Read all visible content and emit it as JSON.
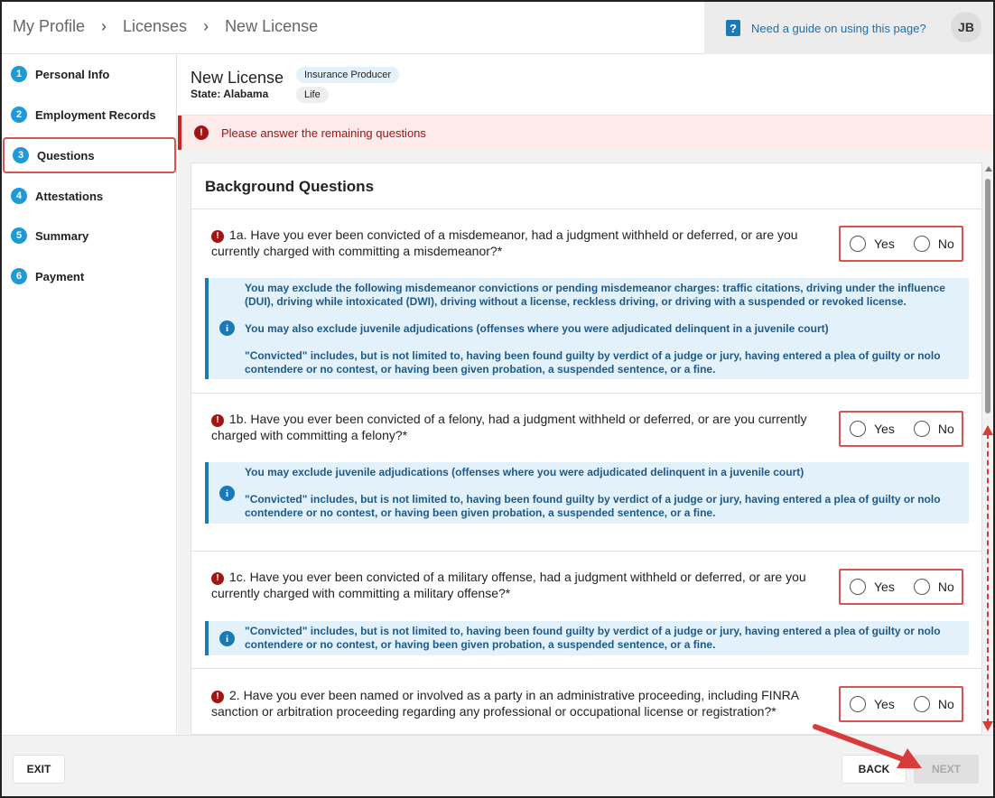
{
  "breadcrumb": [
    "My Profile",
    "Licenses",
    "New License"
  ],
  "guide": {
    "icon": "question-icon",
    "label": "Need a guide on using this page?"
  },
  "user": {
    "initials": "JB"
  },
  "steps": [
    {
      "num": "1",
      "label": "Personal Info"
    },
    {
      "num": "2",
      "label": "Employment Records"
    },
    {
      "num": "3",
      "label": "Questions",
      "active": true
    },
    {
      "num": "4",
      "label": "Attestations"
    },
    {
      "num": "5",
      "label": "Summary"
    },
    {
      "num": "6",
      "label": "Payment"
    }
  ],
  "license": {
    "title": "New License",
    "state": "State: Alabama",
    "chips": [
      "Insurance Producer",
      "Life"
    ]
  },
  "alert": {
    "icon": "error-icon",
    "text": "Please answer the remaining questions"
  },
  "section": {
    "title": "Background Questions"
  },
  "options": {
    "yes": "Yes",
    "no": "No"
  },
  "questions": [
    {
      "text": "1a. Have you ever been convicted of a misdemeanor, had a judgment withheld or deferred, or are you currently charged with committing a misdemeanor?*",
      "info": [
        "You may exclude the following misdemeanor convictions or pending misdemeanor charges: traffic citations, driving under the influence (DUI), driving while intoxicated (DWI), driving without a license, reckless driving, or driving with a suspended or revoked license.",
        "You may also exclude juvenile adjudications (offenses where you were adjudicated delinquent in a juvenile court)",
        "\"Convicted\" includes, but is not limited to, having been found guilty by verdict of a judge or jury, having entered a plea of guilty or nolo contendere or no contest, or having been given probation, a suspended sentence, or a fine."
      ]
    },
    {
      "text": "1b. Have you ever been convicted of a felony, had a judgment withheld or deferred, or are you currently charged with committing a felony?*",
      "info": [
        "You may exclude juvenile adjudications (offenses where you were adjudicated delinquent in a juvenile court)",
        "\"Convicted\" includes, but is not limited to, having been found guilty by verdict of a judge or jury, having entered a plea of guilty or nolo contendere or no contest, or having been given probation, a suspended sentence, or a fine."
      ]
    },
    {
      "text": "1c. Have you ever been convicted of a military offense, had a judgment withheld or deferred, or are you currently charged with committing a military offense?*",
      "info": [
        "\"Convicted\" includes, but is not limited to, having been found guilty by verdict of a judge or jury, having entered a plea of guilty or nolo contendere or no contest, or having been given probation, a suspended sentence, or a fine."
      ]
    },
    {
      "text": "2. Have you ever been named or involved as a party in an administrative proceeding, including FINRA sanction or arbitration proceeding regarding any professional or occupational license or registration?*"
    }
  ],
  "footer": {
    "exit": "EXIT",
    "back": "BACK",
    "next": "NEXT"
  },
  "colors": {
    "accent": "#1e9ad6",
    "error": "#a31515",
    "info_bg": "#e3f1fa",
    "highlight": "#d9534f"
  }
}
